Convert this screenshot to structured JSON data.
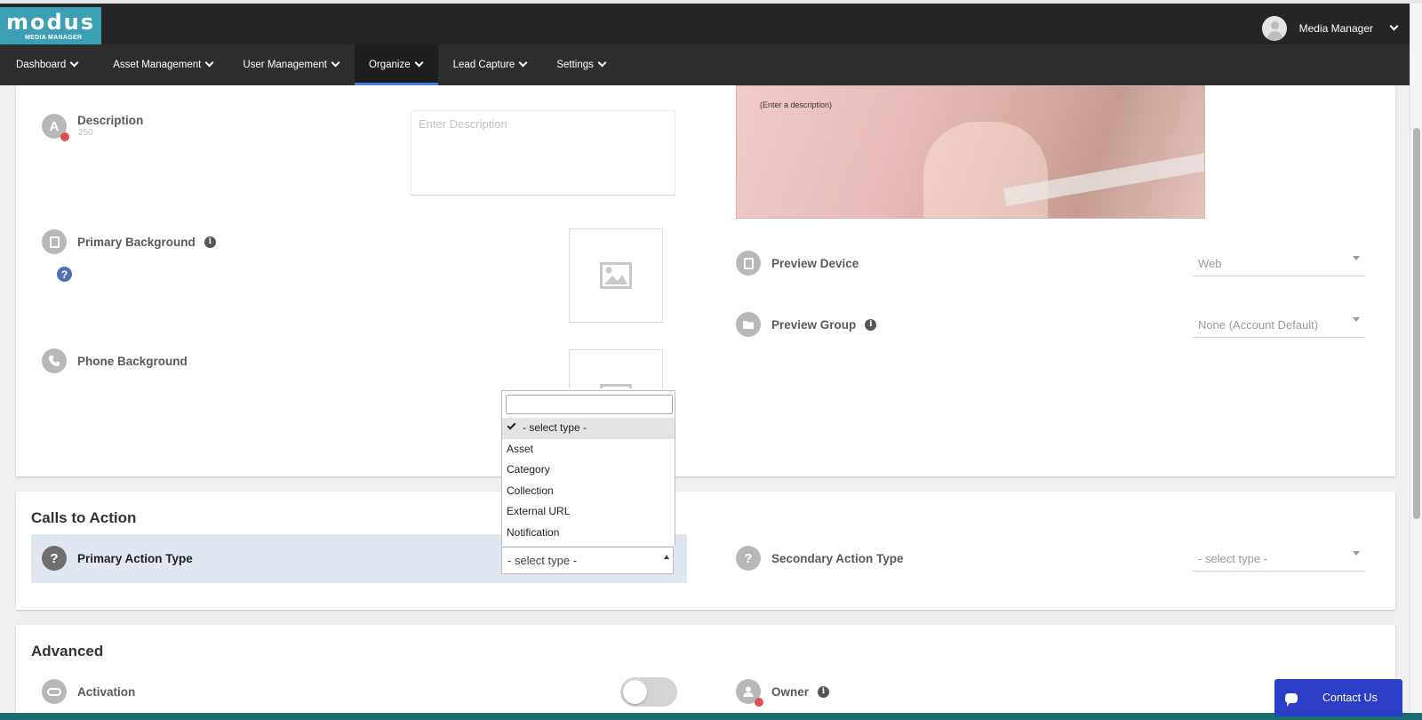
{
  "header": {
    "logo_text": "modus",
    "logo_sub": "MEDIA MANAGER",
    "user_name": "Media Manager"
  },
  "nav": {
    "items": [
      {
        "label": "Dashboard"
      },
      {
        "label": "Asset Management"
      },
      {
        "label": "User Management"
      },
      {
        "label": "Organize",
        "active": true
      },
      {
        "label": "Lead Capture"
      },
      {
        "label": "Settings"
      }
    ]
  },
  "details": {
    "description": {
      "label": "Description",
      "counter": "250",
      "placeholder": "Enter Description",
      "icon_letter": "A"
    },
    "primary_background": {
      "label": "Primary Background",
      "help": "?"
    },
    "phone_background": {
      "label": "Phone Background"
    },
    "preview_hint": "(Enter a description)",
    "preview_device": {
      "label": "Preview Device",
      "value": "Web"
    },
    "preview_group": {
      "label": "Preview Group",
      "value": "None (Account Default)"
    }
  },
  "calls_to_action": {
    "title": "Calls to Action",
    "primary": {
      "label": "Primary Action Type",
      "value": "- select type -"
    },
    "secondary": {
      "label": "Secondary Action Type",
      "value": "- select type -"
    },
    "dropdown_options": [
      "- select type -",
      "Asset",
      "Category",
      "Collection",
      "External URL",
      "Notification"
    ]
  },
  "advanced": {
    "title": "Advanced",
    "activation": {
      "label": "Activation",
      "on": false
    },
    "owner": {
      "label": "Owner"
    }
  },
  "contact_button": "Contact Us"
}
